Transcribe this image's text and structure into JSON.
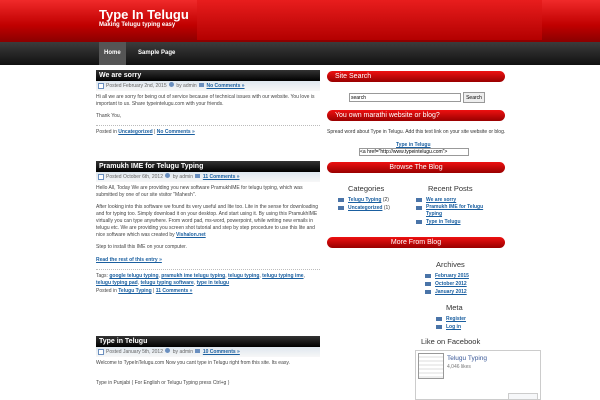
{
  "header": {
    "title": "Type In Telugu",
    "tagline": "Making Telugu typing easy"
  },
  "nav": {
    "items": [
      "Home",
      "Sample Page"
    ]
  },
  "posts": [
    {
      "title": "We are sorry",
      "date": "Posted February 2nd, 2015",
      "by": "by admin",
      "comments": "No Comments »",
      "body": [
        "Hi all we are sorry for being out of service because of technical issues with our website. You love is important to us. Share typeintelugu.com with your friends.",
        "Thank You,"
      ],
      "posted_in": "Posted in",
      "category": "Uncategorized",
      "comments_link": "No Comments »"
    },
    {
      "title": "Pramukh IME for Telugu Typing",
      "date": "Posted October 6th, 2012",
      "by": "by admin",
      "comments": "11 Comments »",
      "body": [
        "Hello All, Today We are providing you new software PramukhIME for telugu typing, which was submitted by one of our site visitor \"Mahesh\".",
        "After looking into this software we found its very useful and lite too. Lite in the sense for downloading and for typing too. Simply download it on your desktop. And start using it. By using this PramukhIME virtually you can type anywhere. From word pad, ms-word, powerpoint, while writing new emails in telugu etc. We are providing you screen shot tutorial and step by step procedure to use this lite and nice software which was created by",
        "Step to install this IME on your computer."
      ],
      "created_by": "Vishalon.net",
      "read_more": "Read the rest of this entry »",
      "tags_label": "Tags:",
      "tags": [
        "google telugu typing",
        "pramukh ime telugu typing",
        "telugu typing",
        "telugu typing ime",
        "telugu typing pad",
        "telugu typing software",
        "type in telugu"
      ],
      "posted_in": "Posted in",
      "category": "Telugu Typing",
      "comments_link": "11 Comments »"
    },
    {
      "title": "Type in Telugu",
      "date": "Posted January 5th, 2012",
      "by": "by admin",
      "comments": "10 Comments »",
      "body": [
        "Welcome to TypeInTelugu.com Now you cant type in Telugu right from this site. Its easy.",
        "Type in Punjabi ( For English or Telugu Typing press Ctrl+g )"
      ]
    }
  ],
  "sidebar": {
    "search_title": "Site Search",
    "search_value": "search",
    "search_button": "Search",
    "own_title": "You own marathi website or blog?",
    "own_text": "Spread word about Type in Telugu. Add this text link on your site website or blog.",
    "link_label": "Type in Telugu",
    "link_code": "<a href=\"http://www.typeintelugu.com\">",
    "browse_title": "Browse The Blog",
    "categories_title": "Categories",
    "categories": [
      {
        "name": "Telugu Typing",
        "count": "(2)"
      },
      {
        "name": "Uncategorized",
        "count": "(1)"
      }
    ],
    "recent_title": "Recent Posts",
    "recent": [
      "We are sorry",
      "Pramukh IME for Telugu Typing",
      "Type in Telugu"
    ],
    "more_title": "More From Blog",
    "archives_title": "Archives",
    "archives": [
      "February 2015",
      "October 2012",
      "January 2012"
    ],
    "meta_title": "Meta",
    "meta": [
      "Register",
      "Log in"
    ],
    "facebook_title": "Like on Facebook",
    "fb_name": "Telugu Typing",
    "fb_likes": "4,046 likes"
  },
  "colors": {
    "accent": "#cc0000",
    "link": "#1a5fa0",
    "title_bar": "#000000"
  }
}
